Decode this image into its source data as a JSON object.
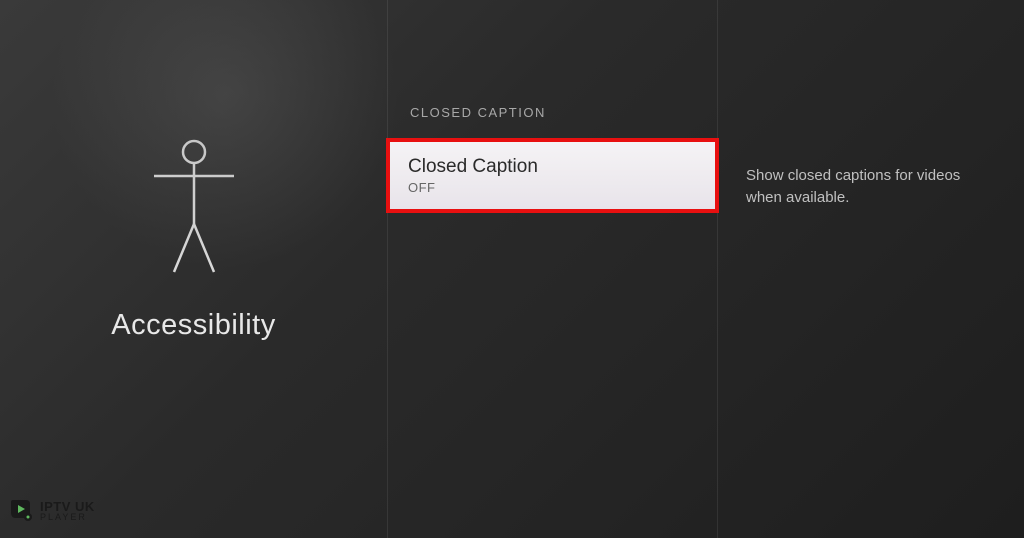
{
  "left": {
    "title": "Accessibility"
  },
  "middle": {
    "section_header": "CLOSED CAPTION",
    "item": {
      "title": "Closed Caption",
      "value": "OFF"
    }
  },
  "right": {
    "description": "Show closed captions for videos when available."
  },
  "watermark": {
    "line1": "IPTV UK",
    "line2": "PLAYER"
  },
  "colors": {
    "highlight_border": "#e81010"
  }
}
